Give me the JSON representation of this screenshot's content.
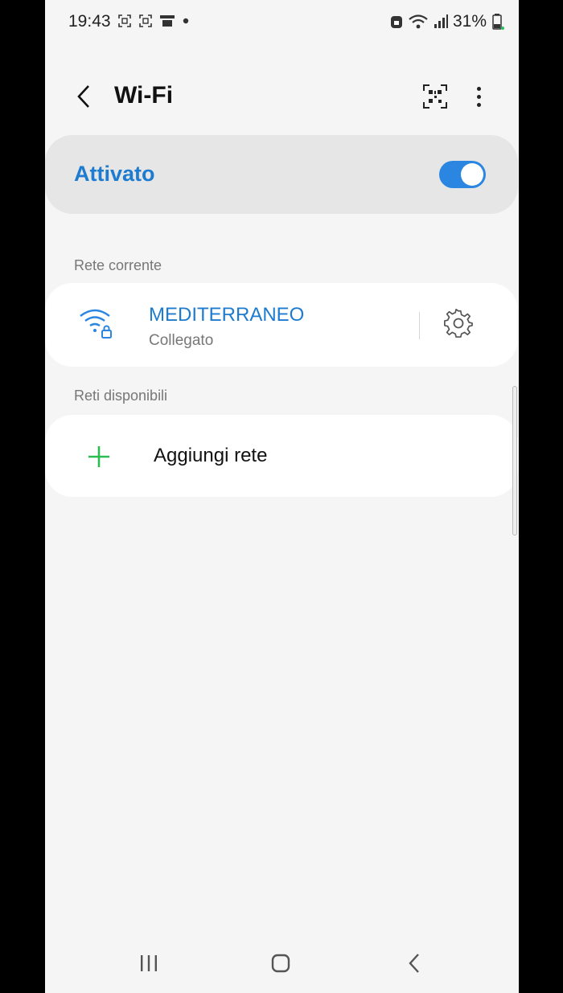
{
  "status_bar": {
    "time": "19:43",
    "battery": "31%"
  },
  "header": {
    "title": "Wi-Fi"
  },
  "master_switch": {
    "label": "Attivato",
    "enabled": true
  },
  "current_network": {
    "section_label": "Rete corrente",
    "name": "MEDITERRANEO",
    "status": "Collegato"
  },
  "available_networks": {
    "section_label": "Reti disponibili",
    "add_label": "Aggiungi rete"
  },
  "colors": {
    "accent": "#1d7bd0",
    "toggle": "#2a86e0",
    "add_icon": "#2dbb54",
    "background": "#f5f5f5"
  },
  "icons": {
    "back": "chevron-left-icon",
    "qr": "qr-code-icon",
    "more": "more-vert-icon",
    "wifi_lock": "wifi-lock-icon",
    "settings": "gear-icon",
    "add": "plus-icon"
  }
}
